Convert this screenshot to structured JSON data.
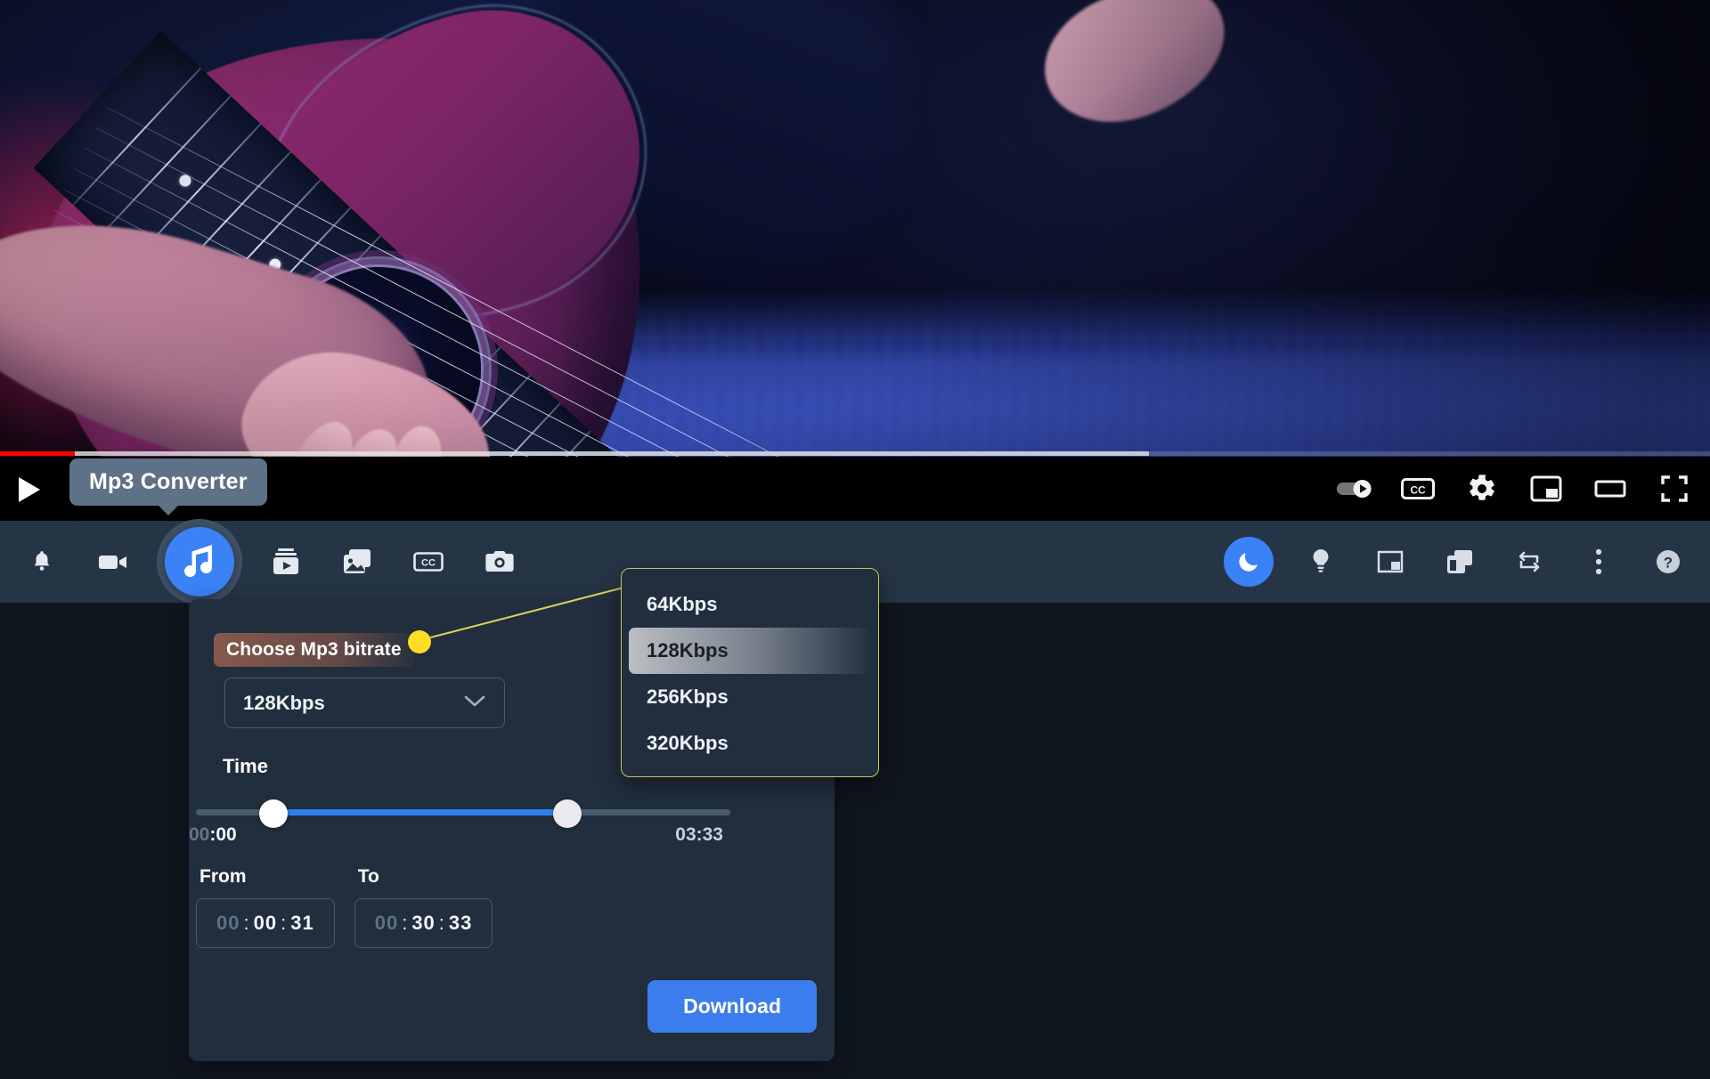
{
  "player": {
    "progress_played_pct": 4.4,
    "progress_loaded_pct": 67.2,
    "play_label": "play-button",
    "right_controls": [
      {
        "name": "autoplay-toggle",
        "label": "Autoplay"
      },
      {
        "name": "subtitles-cc-button",
        "label": "CC"
      },
      {
        "name": "settings-gear-button",
        "label": "Settings"
      },
      {
        "name": "miniplayer-button",
        "label": "Miniplayer"
      },
      {
        "name": "theater-mode-button",
        "label": "Theater mode"
      },
      {
        "name": "fullscreen-button",
        "label": "Fullscreen"
      }
    ]
  },
  "tooltip": {
    "text": "Mp3 Converter"
  },
  "extension_toolbar": {
    "left_items": [
      {
        "name": "notifications-bell-icon",
        "label": "Notifications",
        "active": false
      },
      {
        "name": "video-recorder-icon",
        "label": "Video Recorder",
        "active": false
      },
      {
        "name": "mp3-converter-icon",
        "label": "Mp3 Converter",
        "active": true
      },
      {
        "name": "video-downloader-icon",
        "label": "Video Downloader",
        "active": false
      },
      {
        "name": "image-downloader-icon",
        "label": "Image Downloader",
        "active": false
      },
      {
        "name": "subtitles-cc-icon",
        "label": "Subtitles",
        "active": false
      },
      {
        "name": "screenshot-camera-icon",
        "label": "Screenshot",
        "active": false
      }
    ],
    "right_items": [
      {
        "name": "dark-mode-moon-icon",
        "label": "Dark mode",
        "active": true
      },
      {
        "name": "lightbulb-icon",
        "label": "Tips",
        "active": false
      },
      {
        "name": "picture-in-picture-icon",
        "label": "Picture in picture",
        "active": false
      },
      {
        "name": "copy-windows-icon",
        "label": "Multi window",
        "active": false
      },
      {
        "name": "repeat-loop-icon",
        "label": "Loop",
        "active": false
      },
      {
        "name": "more-options-icon",
        "label": "More options",
        "active": false
      },
      {
        "name": "help-question-icon",
        "label": "Help",
        "active": false
      }
    ]
  },
  "panel": {
    "bitrate_label": "Choose Mp3 bitrate",
    "bitrate_selected": "128Kbps",
    "bitrate_options": [
      {
        "label": "64Kbps",
        "hovered": false
      },
      {
        "label": "128Kbps",
        "hovered": true
      },
      {
        "label": "256Kbps",
        "hovered": false
      },
      {
        "label": "320Kbps",
        "hovered": false
      }
    ],
    "time_heading": "Time",
    "time_start_dim": "00",
    "time_start_lit": ":00",
    "time_end": "03:33",
    "slider": {
      "left_thumb_pct": 14.5,
      "right_thumb_pct": 69.5,
      "fill_left_pct": 14.5,
      "fill_width_pct": 55.0
    },
    "from": {
      "caption": "From",
      "hours": "00",
      "minutes": "00",
      "seconds": "31",
      "separator": ":"
    },
    "to": {
      "caption": "To",
      "hours": "00",
      "minutes": "30",
      "seconds": "33",
      "separator": ":"
    },
    "download_label": "Download"
  },
  "colors": {
    "accent_blue": "#3b82f6",
    "download_blue": "#3b7ded",
    "panel_bg": "#212e3e",
    "toolbar_bg": "#263546",
    "page_bg": "#10161f",
    "highlight_yellow": "#ffdd22",
    "dropdown_border": "#c9c453",
    "progress_red": "#ff0000"
  }
}
